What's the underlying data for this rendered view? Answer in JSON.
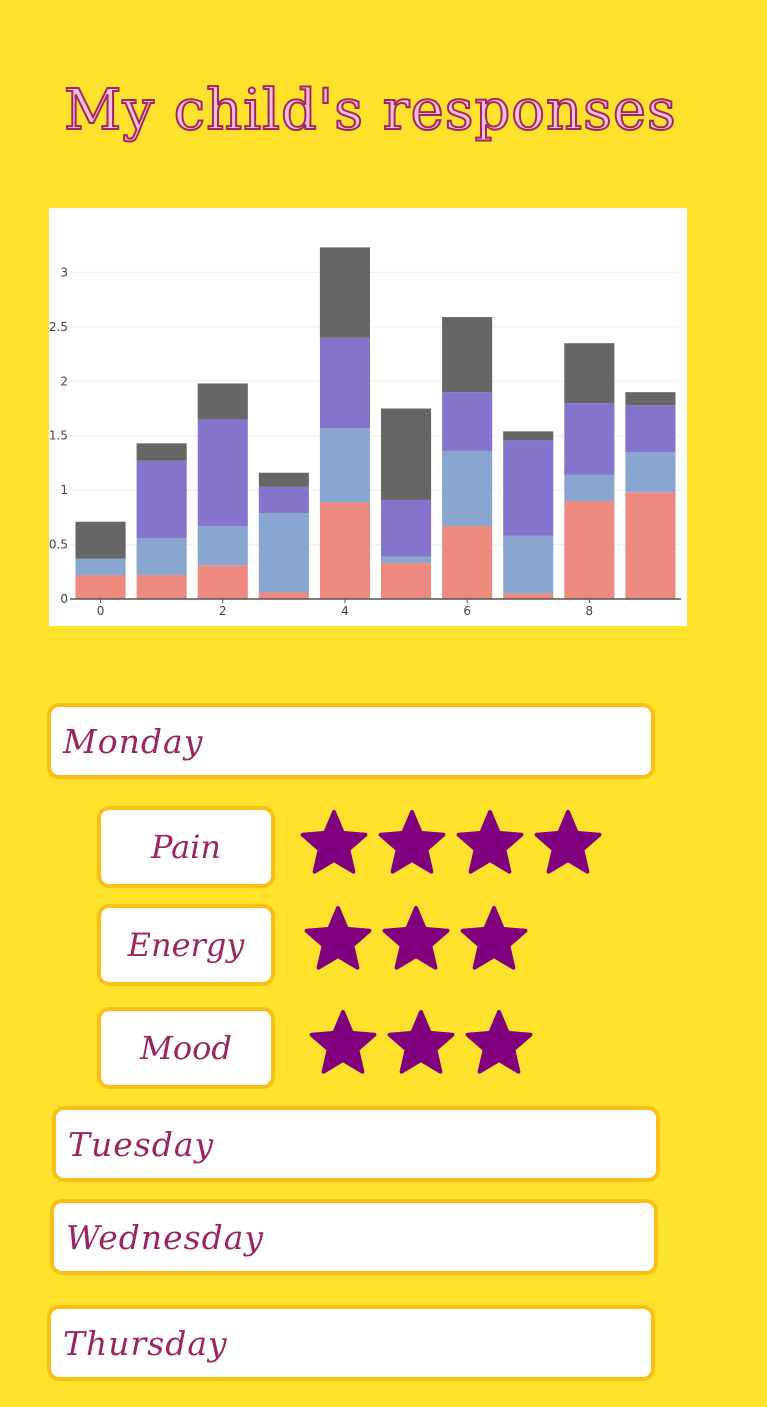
{
  "title": "My child's responses",
  "chart_data": {
    "type": "bar",
    "stacked": true,
    "x": [
      0,
      1,
      2,
      3,
      4,
      5,
      6,
      7,
      8,
      9
    ],
    "series": [
      {
        "color": "#ec8a80",
        "values": [
          0.22,
          0.22,
          0.31,
          0.06,
          0.89,
          0.33,
          0.67,
          0.05,
          0.9,
          0.98
        ]
      },
      {
        "color": "#88a6cf",
        "values": [
          0.15,
          0.34,
          0.36,
          0.73,
          0.68,
          0.06,
          0.69,
          0.53,
          0.24,
          0.37
        ]
      },
      {
        "color": "#8674cc",
        "values": [
          0.0,
          0.71,
          0.98,
          0.24,
          0.83,
          0.52,
          0.54,
          0.88,
          0.66,
          0.43
        ]
      },
      {
        "color": "#666666",
        "values": [
          0.34,
          0.16,
          0.33,
          0.13,
          0.83,
          0.84,
          0.69,
          0.08,
          0.55,
          0.12
        ]
      }
    ],
    "xticks": [
      "0",
      "2",
      "4",
      "6",
      "8"
    ],
    "yticks": [
      "0",
      "0.5",
      "1",
      "1.5",
      "2",
      "2.5",
      "3"
    ],
    "ylim": [
      0,
      3.5
    ],
    "grid": true
  },
  "days": [
    {
      "label": "Monday"
    },
    {
      "label": "Tuesday"
    },
    {
      "label": "Wednesday"
    },
    {
      "label": "Thursday"
    }
  ],
  "metrics": [
    {
      "label": "Pain",
      "stars": 4
    },
    {
      "label": "Energy",
      "stars": 3
    },
    {
      "label": "Mood",
      "stars": 3
    }
  ],
  "colors": {
    "background": "#ffe22e",
    "box_border": "#f8c014",
    "label_text": "#9b2563",
    "star": "#800080",
    "title_fill": "#f5c0dc",
    "title_outline": "#a0285f"
  },
  "icons": {
    "rating": "star-icon"
  }
}
